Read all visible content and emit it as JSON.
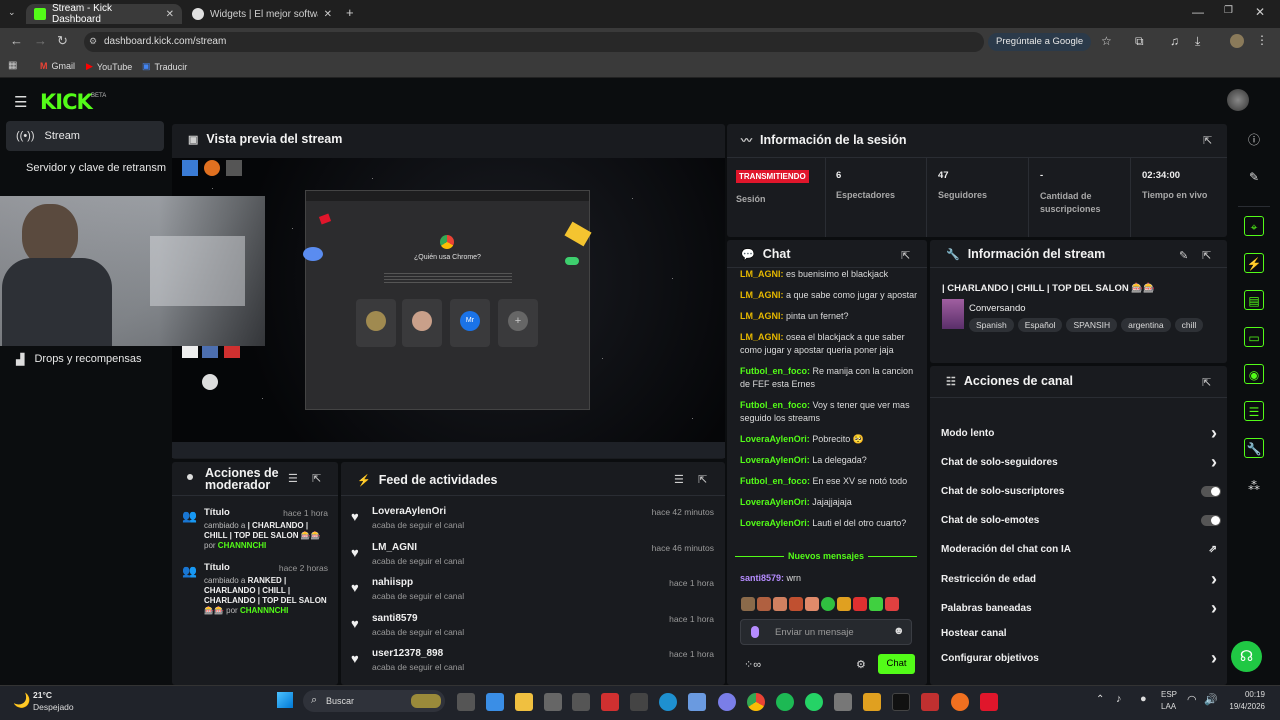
{
  "browser": {
    "tabs": [
      {
        "title": "Stream - Kick Dashboard"
      },
      {
        "title": "Widgets | El mejor software par"
      }
    ],
    "url": "dashboard.kick.com/stream",
    "ask_google": "Pregúntale a Google",
    "bookmarks": [
      "Gmail",
      "YouTube",
      "Traducir"
    ]
  },
  "app": {
    "logo": "KICK",
    "beta": "BETA",
    "colors": {
      "accent": "#53fc18",
      "live": "#e0162b",
      "panel": "#191b1f"
    }
  },
  "sidebar": {
    "items": [
      {
        "label": "Stream"
      },
      {
        "label": "Servidor y clave de retransm"
      },
      {
        "label": "Drops y recompensas"
      }
    ]
  },
  "preview": {
    "title": "Vista previa del stream",
    "chrome_question": "¿Quién usa Chrome?",
    "chrome_profiles": [
      "Mr"
    ]
  },
  "session": {
    "title": "Información de la sesión",
    "live_badge": "TRANSMITIENDO",
    "live_label": "Sesión",
    "stats": [
      {
        "value": "6",
        "label": "Espectadores"
      },
      {
        "value": "47",
        "label": "Seguidores"
      },
      {
        "value": "-",
        "label": "Cantidad de suscripciones"
      },
      {
        "value": "02:34:00",
        "label": "Tiempo en vivo"
      }
    ]
  },
  "chat": {
    "title": "Chat",
    "messages": [
      {
        "user": "LM_AGNI:",
        "text": "es buenisimo el blackjack"
      },
      {
        "user": "LM_AGNI:",
        "text": "a que sabe como jugar y apostar"
      },
      {
        "user": "LM_AGNI:",
        "text": "pinta un fernet?"
      },
      {
        "user": "LM_AGNI:",
        "text": "osea el blackjack a que saber como jugar y apostar queria poner jaja"
      },
      {
        "user": "Futbol_en_foco:",
        "text": "Re manija con la cancion de FEF esta Ernes"
      },
      {
        "user": "Futbol_en_foco:",
        "text": "Voy s tener que ver mas seguido los streams"
      },
      {
        "user": "LoveraAylenOri:",
        "text": "Pobrecito 🥺"
      },
      {
        "user": "LoveraAylenOri:",
        "text": "La delegada?"
      },
      {
        "user": "Futbol_en_foco:",
        "text": "En ese XV se notó todo"
      },
      {
        "user": "LoveraAylenOri:",
        "text": "Jajajjajaja"
      },
      {
        "user": "LoveraAylenOri:",
        "text": "Lauti el del otro cuarto?"
      }
    ],
    "new_messages": "Nuevos mensajes",
    "last_message": {
      "user": "santi8579:",
      "text": "wrn"
    },
    "input_placeholder": "Enviar un mensaje",
    "send_label": "Chat"
  },
  "stream_info": {
    "title": "Información del stream",
    "stream_title": "| CHARLANDO | CHILL | TOP DEL SALON 🎰🎰",
    "category": "Conversando",
    "tags": [
      "Spanish",
      "Español",
      "SPANSIH",
      "argentina",
      "chill"
    ]
  },
  "channel_actions": {
    "title": "Acciones de canal",
    "items": [
      {
        "label": "Modo lento",
        "control": "chevron"
      },
      {
        "label": "Chat de solo-seguidores",
        "control": "chevron"
      },
      {
        "label": "Chat de solo-suscriptores",
        "control": "toggle"
      },
      {
        "label": "Chat de solo-emotes",
        "control": "toggle"
      },
      {
        "label": "Moderación del chat con IA",
        "control": "external"
      },
      {
        "label": "Restricción de edad",
        "control": "chevron"
      },
      {
        "label": "Palabras baneadas",
        "control": "chevron"
      },
      {
        "label": "Hostear canal",
        "control": "none"
      },
      {
        "label": "Configurar objetivos",
        "control": "chevron"
      }
    ]
  },
  "moderator": {
    "title": "Acciones de moderador",
    "entries": [
      {
        "field": "Título",
        "time": "hace 1 hora",
        "changed_prefix": "cambiado a",
        "value": "| CHARLANDO | CHILL | TOP DEL SALON 🎰🎰",
        "by_prefix": "por",
        "by": "CHANNNCHI"
      },
      {
        "field": "Título",
        "time": "hace 2 horas",
        "changed_prefix": "cambiado a",
        "value": "RANKED | CHARLANDO | CHILL | CHARLANDO | TOP DEL SALON 🎰🎰",
        "by_prefix": "por",
        "by": "CHANNNCHI"
      }
    ]
  },
  "feed": {
    "title": "Feed de actividades",
    "entries": [
      {
        "user": "LoveraAylenOri",
        "action": "acaba de seguir el canal",
        "time": "hace 42 minutos"
      },
      {
        "user": "LM_AGNI",
        "action": "acaba de seguir el canal",
        "time": "hace 46 minutos"
      },
      {
        "user": "nahiispp",
        "action": "acaba de seguir el canal",
        "time": "hace 1 hora"
      },
      {
        "user": "santi8579",
        "action": "acaba de seguir el canal",
        "time": "hace 1 hora"
      },
      {
        "user": "user12378_898",
        "action": "acaba de seguir el canal",
        "time": "hace 1 hora"
      }
    ]
  },
  "taskbar": {
    "weather_temp": "21°C",
    "weather_desc": "Despejado",
    "search_label": "Buscar",
    "lang_top": "ESP",
    "lang_bottom": "LAA",
    "time": "00:19",
    "date": "19/4/2026"
  }
}
